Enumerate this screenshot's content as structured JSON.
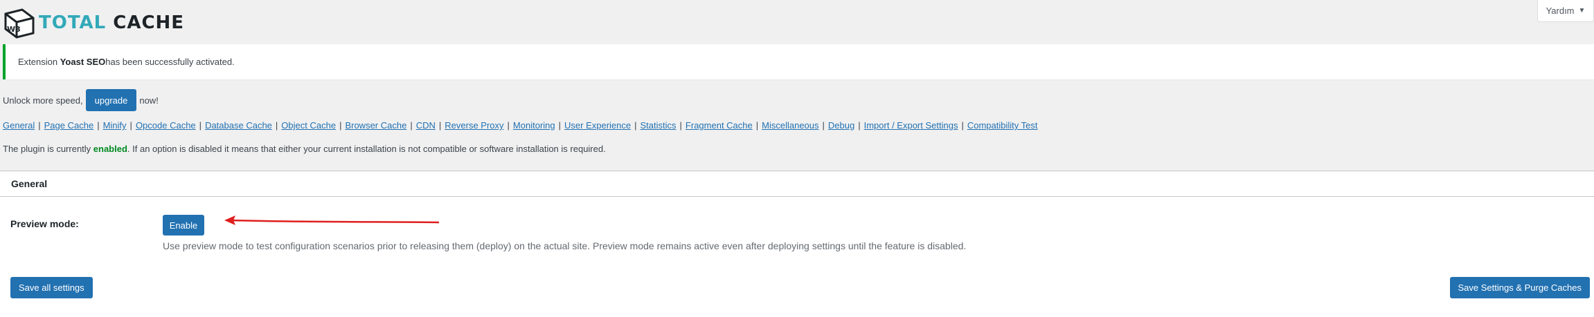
{
  "header": {
    "logo_text_1": "TOTAL",
    "logo_text_2": "CACHE",
    "logo_badge": "W3",
    "help_label": "Yardım",
    "help_icon": "caret-down-icon"
  },
  "notice": {
    "prefix": "Extension ",
    "extension": "Yoast SEO",
    "suffix": " has been successfully activated.",
    "color": "#00a32a"
  },
  "unlock": {
    "prefix": "Unlock more speed,",
    "button": "upgrade",
    "suffix": "now!"
  },
  "nav": {
    "links": [
      "General",
      "Page Cache",
      "Minify",
      "Opcode Cache",
      "Database Cache",
      "Object Cache",
      "Browser Cache",
      "CDN",
      "Reverse Proxy",
      "Monitoring",
      "User Experience",
      "Statistics",
      "Fragment Cache",
      "Miscellaneous",
      "Debug",
      "Import / Export Settings",
      "Compatibility Test"
    ],
    "separator": "|"
  },
  "status": {
    "prefix": "The plugin is currently ",
    "state": "enabled",
    "suffix": ". If an option is disabled it means that either your current installation is not compatible or software installation is required."
  },
  "general": {
    "title": "General",
    "preview_label": "Preview mode:",
    "enable_button": "Enable",
    "description": "Use preview mode to test configuration scenarios prior to releasing them (deploy) on the actual site. Preview mode remains active even after deploying settings until the feature is disabled.",
    "save_button": "Save all settings",
    "purge_button": "Save Settings & Purge Caches"
  },
  "colors": {
    "primary": "#2271b1",
    "accent_teal": "#32a9b8",
    "annotation": "#e01e1e",
    "enabled_green": "#008a20"
  }
}
